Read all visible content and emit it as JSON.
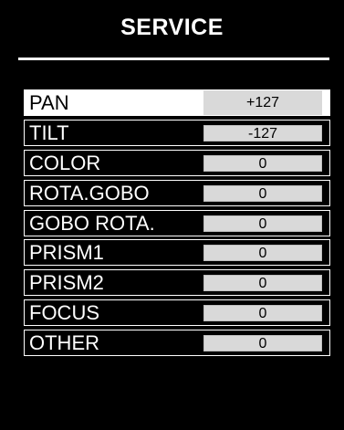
{
  "header": {
    "title": "SERVICE"
  },
  "service_items": [
    {
      "label": "PAN",
      "value": "+127",
      "selected": true
    },
    {
      "label": "TILT",
      "value": "-127",
      "selected": false
    },
    {
      "label": "COLOR",
      "value": "0",
      "selected": false
    },
    {
      "label": "ROTA.GOBO",
      "value": "0",
      "selected": false
    },
    {
      "label": "GOBO ROTA.",
      "value": "0",
      "selected": false
    },
    {
      "label": "PRISM1",
      "value": "0",
      "selected": false
    },
    {
      "label": "PRISM2",
      "value": "0",
      "selected": false
    },
    {
      "label": "FOCUS",
      "value": "0",
      "selected": false
    },
    {
      "label": "OTHER",
      "value": "0",
      "selected": false
    }
  ],
  "colors": {
    "background": "#000000",
    "foreground": "#ffffff",
    "value_field": "#d9d9d9",
    "selected_row": "#ffffff"
  }
}
